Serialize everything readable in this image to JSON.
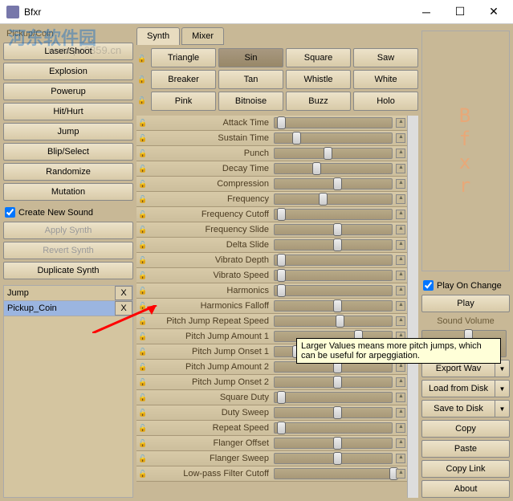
{
  "window": {
    "title": "Bfxr"
  },
  "watermark": {
    "text": "河东软件园",
    "url": "www.pc0359.cn"
  },
  "presets": {
    "current": "Pickup/Coin",
    "buttons": [
      "Laser/Shoot",
      "Explosion",
      "Powerup",
      "Hit/Hurt",
      "Jump",
      "Blip/Select",
      "Randomize",
      "Mutation"
    ]
  },
  "options": {
    "create_new_sound": "Create New Sound",
    "apply_synth": "Apply Synth",
    "revert_synth": "Revert Synth",
    "duplicate_synth": "Duplicate Synth"
  },
  "sounds": [
    {
      "name": "Jump",
      "selected": false
    },
    {
      "name": "Pickup_Coin",
      "selected": true
    }
  ],
  "del_label": "X",
  "tabs": {
    "synth": "Synth",
    "mixer": "Mixer"
  },
  "waves": [
    "Triangle",
    "Sin",
    "Square",
    "Saw",
    "Breaker",
    "Tan",
    "Whistle",
    "White",
    "Pink",
    "Bitnoise",
    "Buzz",
    "Holo"
  ],
  "wave_active_index": 1,
  "params": [
    {
      "label": "Attack Time",
      "pos": 2
    },
    {
      "label": "Sustain Time",
      "pos": 15
    },
    {
      "label": "Punch",
      "pos": 42
    },
    {
      "label": "Decay Time",
      "pos": 32
    },
    {
      "label": "Compression",
      "pos": 50
    },
    {
      "label": "Frequency",
      "pos": 38
    },
    {
      "label": "Frequency Cutoff",
      "pos": 2
    },
    {
      "label": "Frequency Slide",
      "pos": 50
    },
    {
      "label": "Delta Slide",
      "pos": 50
    },
    {
      "label": "Vibrato Depth",
      "pos": 2
    },
    {
      "label": "Vibrato Speed",
      "pos": 2
    },
    {
      "label": "Harmonics",
      "pos": 2
    },
    {
      "label": "Harmonics Falloff",
      "pos": 50
    },
    {
      "label": "Pitch Jump Repeat Speed",
      "pos": 52
    },
    {
      "label": "Pitch Jump Amount 1",
      "pos": 68
    },
    {
      "label": "Pitch Jump Onset 1",
      "pos": 15
    },
    {
      "label": "Pitch Jump Amount 2",
      "pos": 50
    },
    {
      "label": "Pitch Jump Onset 2",
      "pos": 50
    },
    {
      "label": "Square Duty",
      "pos": 2
    },
    {
      "label": "Duty Sweep",
      "pos": 50
    },
    {
      "label": "Repeat Speed",
      "pos": 2
    },
    {
      "label": "Flanger Offset",
      "pos": 50
    },
    {
      "label": "Flanger Sweep",
      "pos": 50
    },
    {
      "label": "Low-pass Filter Cutoff",
      "pos": 98
    }
  ],
  "right": {
    "logo": "Bfxr",
    "play_on_change": "Play On Change",
    "play": "Play",
    "sound_volume": "Sound Volume",
    "export_wav": "Export Wav",
    "load": "Load from Disk",
    "save": "Save to Disk",
    "copy": "Copy",
    "paste": "Paste",
    "copy_link": "Copy Link",
    "about": "About"
  },
  "tooltip": "Larger Values means more pitch jumps, which can be useful for arpeggiation."
}
